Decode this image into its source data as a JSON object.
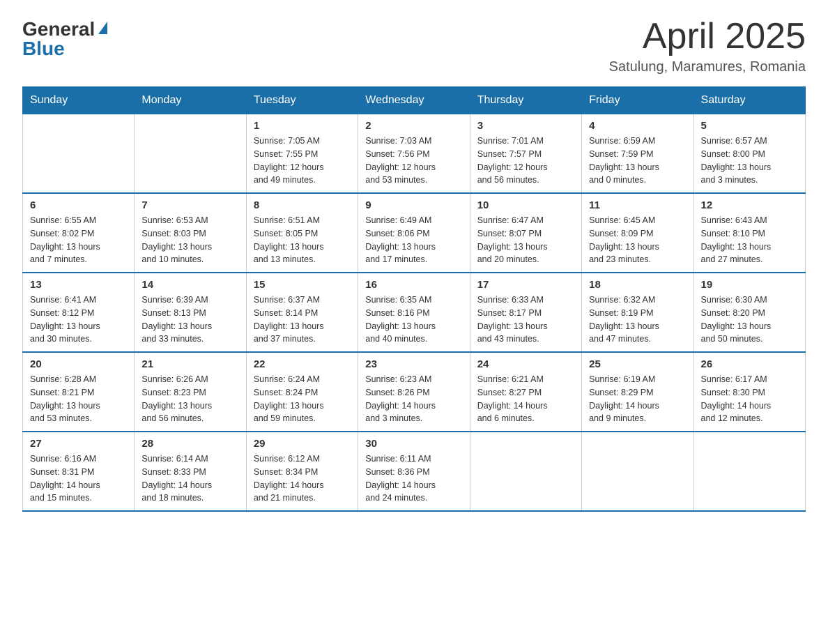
{
  "logo": {
    "general": "General",
    "blue": "Blue"
  },
  "title": "April 2025",
  "subtitle": "Satulung, Maramures, Romania",
  "days_of_week": [
    "Sunday",
    "Monday",
    "Tuesday",
    "Wednesday",
    "Thursday",
    "Friday",
    "Saturday"
  ],
  "weeks": [
    [
      {
        "day": "",
        "info": ""
      },
      {
        "day": "",
        "info": ""
      },
      {
        "day": "1",
        "info": "Sunrise: 7:05 AM\nSunset: 7:55 PM\nDaylight: 12 hours\nand 49 minutes."
      },
      {
        "day": "2",
        "info": "Sunrise: 7:03 AM\nSunset: 7:56 PM\nDaylight: 12 hours\nand 53 minutes."
      },
      {
        "day": "3",
        "info": "Sunrise: 7:01 AM\nSunset: 7:57 PM\nDaylight: 12 hours\nand 56 minutes."
      },
      {
        "day": "4",
        "info": "Sunrise: 6:59 AM\nSunset: 7:59 PM\nDaylight: 13 hours\nand 0 minutes."
      },
      {
        "day": "5",
        "info": "Sunrise: 6:57 AM\nSunset: 8:00 PM\nDaylight: 13 hours\nand 3 minutes."
      }
    ],
    [
      {
        "day": "6",
        "info": "Sunrise: 6:55 AM\nSunset: 8:02 PM\nDaylight: 13 hours\nand 7 minutes."
      },
      {
        "day": "7",
        "info": "Sunrise: 6:53 AM\nSunset: 8:03 PM\nDaylight: 13 hours\nand 10 minutes."
      },
      {
        "day": "8",
        "info": "Sunrise: 6:51 AM\nSunset: 8:05 PM\nDaylight: 13 hours\nand 13 minutes."
      },
      {
        "day": "9",
        "info": "Sunrise: 6:49 AM\nSunset: 8:06 PM\nDaylight: 13 hours\nand 17 minutes."
      },
      {
        "day": "10",
        "info": "Sunrise: 6:47 AM\nSunset: 8:07 PM\nDaylight: 13 hours\nand 20 minutes."
      },
      {
        "day": "11",
        "info": "Sunrise: 6:45 AM\nSunset: 8:09 PM\nDaylight: 13 hours\nand 23 minutes."
      },
      {
        "day": "12",
        "info": "Sunrise: 6:43 AM\nSunset: 8:10 PM\nDaylight: 13 hours\nand 27 minutes."
      }
    ],
    [
      {
        "day": "13",
        "info": "Sunrise: 6:41 AM\nSunset: 8:12 PM\nDaylight: 13 hours\nand 30 minutes."
      },
      {
        "day": "14",
        "info": "Sunrise: 6:39 AM\nSunset: 8:13 PM\nDaylight: 13 hours\nand 33 minutes."
      },
      {
        "day": "15",
        "info": "Sunrise: 6:37 AM\nSunset: 8:14 PM\nDaylight: 13 hours\nand 37 minutes."
      },
      {
        "day": "16",
        "info": "Sunrise: 6:35 AM\nSunset: 8:16 PM\nDaylight: 13 hours\nand 40 minutes."
      },
      {
        "day": "17",
        "info": "Sunrise: 6:33 AM\nSunset: 8:17 PM\nDaylight: 13 hours\nand 43 minutes."
      },
      {
        "day": "18",
        "info": "Sunrise: 6:32 AM\nSunset: 8:19 PM\nDaylight: 13 hours\nand 47 minutes."
      },
      {
        "day": "19",
        "info": "Sunrise: 6:30 AM\nSunset: 8:20 PM\nDaylight: 13 hours\nand 50 minutes."
      }
    ],
    [
      {
        "day": "20",
        "info": "Sunrise: 6:28 AM\nSunset: 8:21 PM\nDaylight: 13 hours\nand 53 minutes."
      },
      {
        "day": "21",
        "info": "Sunrise: 6:26 AM\nSunset: 8:23 PM\nDaylight: 13 hours\nand 56 minutes."
      },
      {
        "day": "22",
        "info": "Sunrise: 6:24 AM\nSunset: 8:24 PM\nDaylight: 13 hours\nand 59 minutes."
      },
      {
        "day": "23",
        "info": "Sunrise: 6:23 AM\nSunset: 8:26 PM\nDaylight: 14 hours\nand 3 minutes."
      },
      {
        "day": "24",
        "info": "Sunrise: 6:21 AM\nSunset: 8:27 PM\nDaylight: 14 hours\nand 6 minutes."
      },
      {
        "day": "25",
        "info": "Sunrise: 6:19 AM\nSunset: 8:29 PM\nDaylight: 14 hours\nand 9 minutes."
      },
      {
        "day": "26",
        "info": "Sunrise: 6:17 AM\nSunset: 8:30 PM\nDaylight: 14 hours\nand 12 minutes."
      }
    ],
    [
      {
        "day": "27",
        "info": "Sunrise: 6:16 AM\nSunset: 8:31 PM\nDaylight: 14 hours\nand 15 minutes."
      },
      {
        "day": "28",
        "info": "Sunrise: 6:14 AM\nSunset: 8:33 PM\nDaylight: 14 hours\nand 18 minutes."
      },
      {
        "day": "29",
        "info": "Sunrise: 6:12 AM\nSunset: 8:34 PM\nDaylight: 14 hours\nand 21 minutes."
      },
      {
        "day": "30",
        "info": "Sunrise: 6:11 AM\nSunset: 8:36 PM\nDaylight: 14 hours\nand 24 minutes."
      },
      {
        "day": "",
        "info": ""
      },
      {
        "day": "",
        "info": ""
      },
      {
        "day": "",
        "info": ""
      }
    ]
  ]
}
